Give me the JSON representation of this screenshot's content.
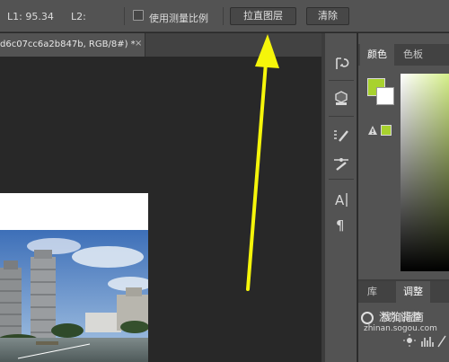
{
  "options_bar": {
    "l1_label": "L1: 95.34",
    "l2_label": "L2:",
    "use_scale_label": "使用测量比例",
    "straighten_button": "拉直图层",
    "clear_button": "清除"
  },
  "document_tab": {
    "title": "d6c07cc6a2b847b, RGB/8#) *",
    "close": "×"
  },
  "panels": {
    "collapse": "◂◂",
    "color_tabs": [
      "颜色",
      "色板"
    ],
    "bottom_tabs": [
      "库",
      "调整"
    ],
    "adjustments_header": "添加调整"
  },
  "watermark": {
    "brand": "搜狗指南",
    "url": "zhinan.sogou.com"
  },
  "colors": {
    "foreground": "#a8d22e",
    "background": "#ffffff",
    "annotation_arrow": "#f5f50a"
  }
}
